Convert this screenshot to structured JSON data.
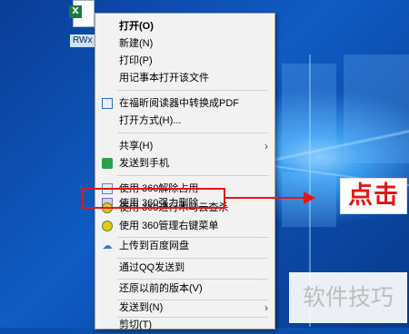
{
  "desktop": {
    "file_label": "RWx"
  },
  "context_menu": {
    "items": [
      {
        "label": "打开(O)",
        "bold": true
      },
      {
        "label": "新建(N)"
      },
      {
        "label": "打印(P)"
      },
      {
        "label": "用记事本打开该文件"
      },
      {
        "label": "在福昕阅读器中转换成PDF",
        "icon": "pdf-icon"
      },
      {
        "label": "打开方式(H)..."
      },
      {
        "label": "共享(H)",
        "submenu": true
      },
      {
        "label": "发送到手机",
        "icon": "phone-send-icon"
      },
      {
        "label": "使用 360解除占用",
        "icon": "unlock-360-icon"
      },
      {
        "label": "使用 360强力删除",
        "icon": "delete-360-icon"
      },
      {
        "label": "使用 360进行木马云查杀",
        "icon": "trojan-scan-360-icon"
      },
      {
        "label": "使用 360管理右键菜单",
        "icon": "menu-manage-360-icon"
      },
      {
        "label": "上传到百度网盘",
        "icon": "baidu-cloud-icon"
      },
      {
        "label": "通过QQ发送到"
      },
      {
        "label": "还原以前的版本(V)"
      },
      {
        "label": "发送到(N)",
        "submenu": true
      },
      {
        "label": "剪切(T)"
      }
    ]
  },
  "annotation": {
    "callout_text": "点击",
    "accent_color": "#e01818"
  },
  "watermark": "软件技巧"
}
